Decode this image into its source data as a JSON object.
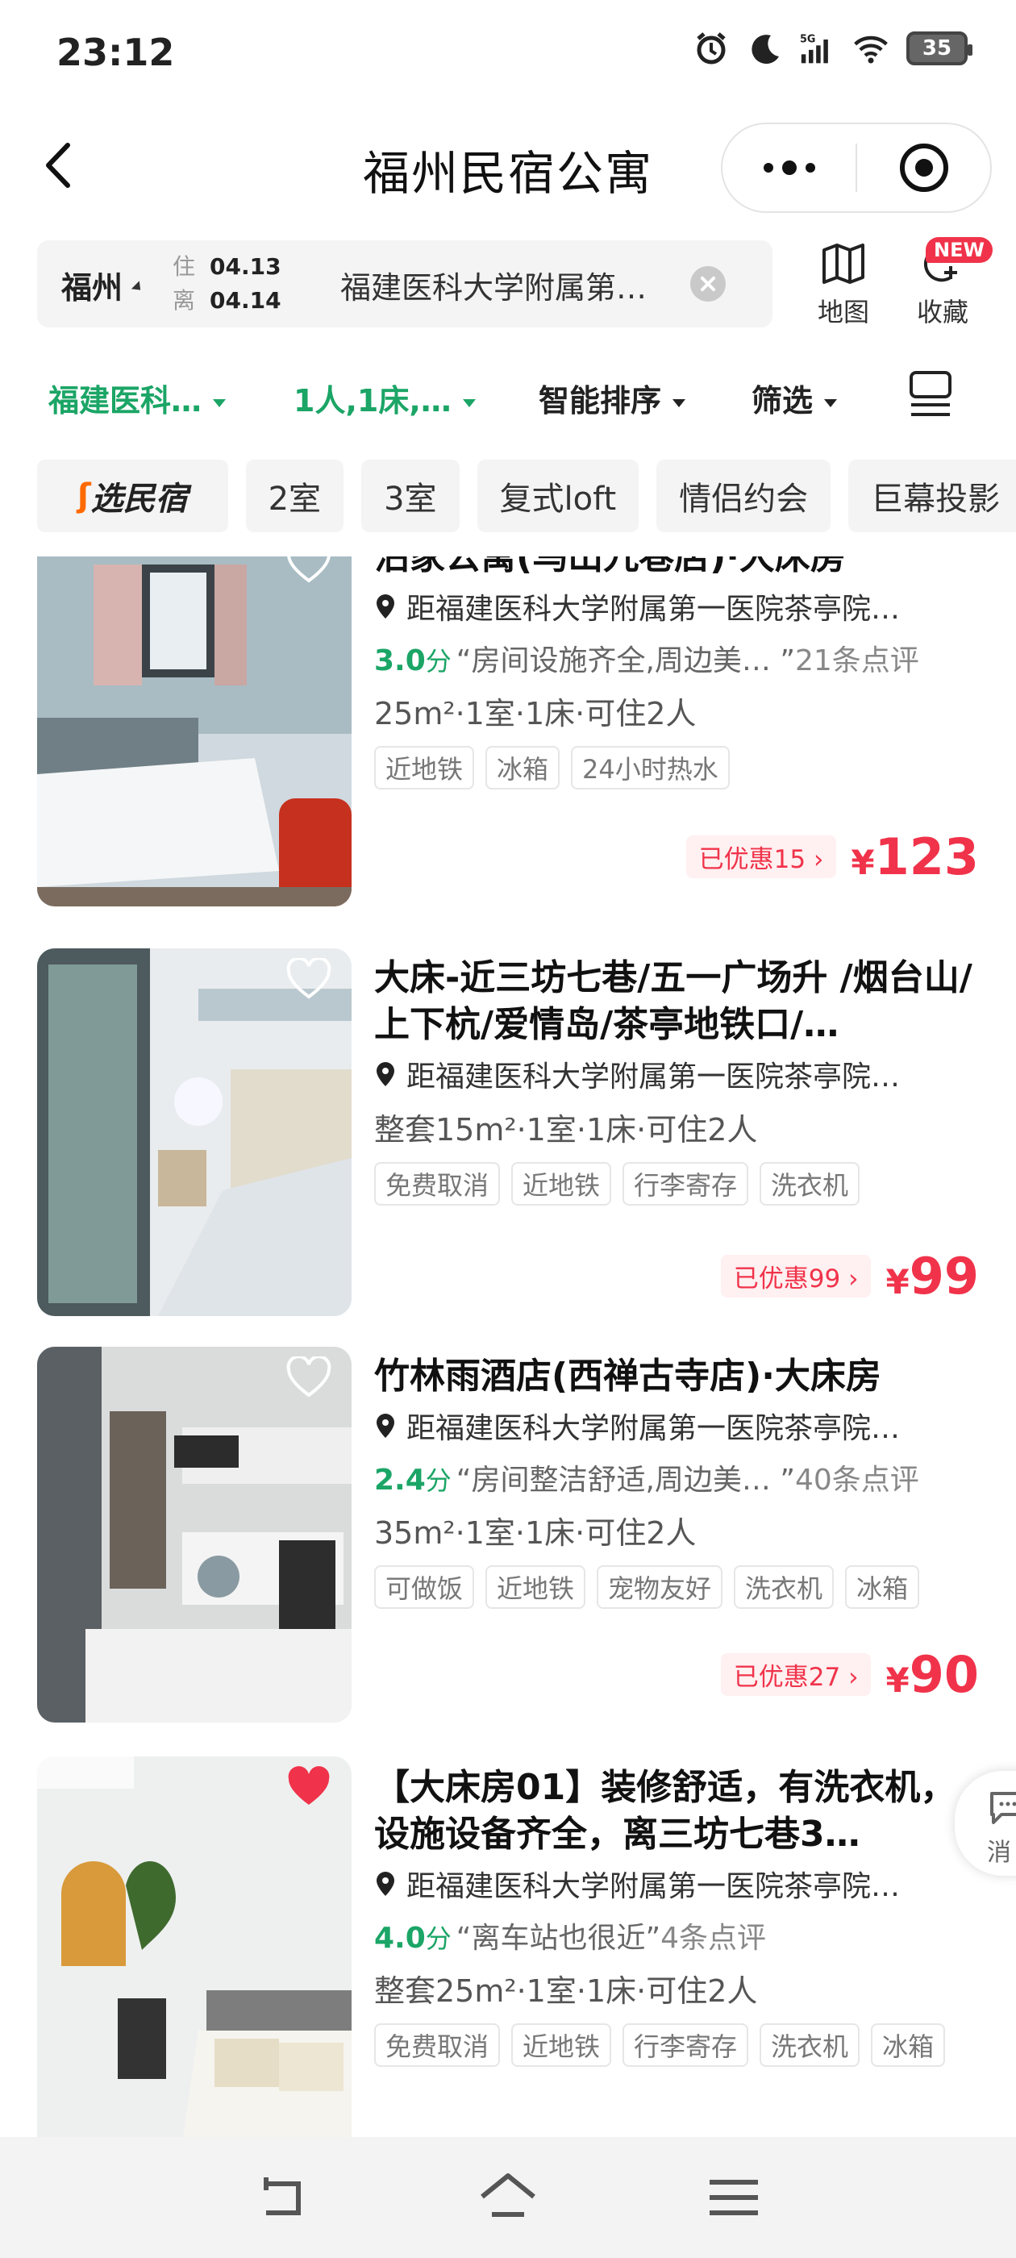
{
  "status": {
    "time": "23:12",
    "battery": "35",
    "network": "5G"
  },
  "nav": {
    "title": "福州民宿公寓"
  },
  "search": {
    "city": "福州",
    "checkin_label": "住",
    "checkin": "04.13",
    "checkout_label": "离",
    "checkout": "04.14",
    "keyword": "福建医科大学附属第…"
  },
  "actions": {
    "map": "地图",
    "favorites": "收藏",
    "new_badge": "NEW"
  },
  "filters": {
    "location": "福建医科…",
    "guests": "1人,1床,…",
    "sort": "智能排序",
    "filter": "筛选"
  },
  "tags": {
    "brand_icon": "ʃ",
    "brand_rest": "选民宿",
    "items": [
      "2室",
      "3室",
      "复式loft",
      "情侣约会",
      "巨幕投影"
    ]
  },
  "listings": [
    {
      "title": "泊家公寓(乌山九巷店)·大床房",
      "location": "距福建医科大学附属第一医院茶亭院…",
      "score": "3.0",
      "score_unit": "分",
      "quote": "“房间设施齐全,周边美… ”",
      "reviews": "21条点评",
      "spec": "25m²·1室·1床·可住2人",
      "tags": [
        "近地铁",
        "冰箱",
        "24小时热水"
      ],
      "discount": "已优惠15 ›",
      "currency": "¥",
      "price": "123",
      "favorited": false
    },
    {
      "title": "大床-近三坊七巷/五一广场升 /烟台山/上下杭/爱情岛/茶亭地铁口/…",
      "location": "距福建医科大学附属第一医院茶亭院…",
      "spec": "整套15m²·1室·1床·可住2人",
      "tags": [
        "免费取消",
        "近地铁",
        "行李寄存",
        "洗衣机"
      ],
      "discount": "已优惠99 ›",
      "currency": "¥",
      "price": "99",
      "favorited": false
    },
    {
      "title": "竹林雨酒店(西禅古寺店)·大床房",
      "location": "距福建医科大学附属第一医院茶亭院…",
      "score": "2.4",
      "score_unit": "分",
      "quote": "“房间整洁舒适,周边美… ”",
      "reviews": "40条点评",
      "spec": "35m²·1室·1床·可住2人",
      "tags": [
        "可做饭",
        "近地铁",
        "宠物友好",
        "洗衣机",
        "冰箱"
      ],
      "discount": "已优惠27 ›",
      "currency": "¥",
      "price": "90",
      "favorited": false
    },
    {
      "title": "【大床房01】装修舒适，有洗衣机，设施设备齐全，离三坊七巷3…",
      "location": "距福建医科大学附属第一医院茶亭院…",
      "score": "4.0",
      "score_unit": "分",
      "quote": "“离车站也很近”",
      "reviews": "4条点评",
      "spec": "整套25m²·1室·1床·可住2人",
      "tags": [
        "免费取消",
        "近地铁",
        "行李寄存",
        "洗衣机",
        "冰箱"
      ],
      "favorited": true
    }
  ],
  "floating": {
    "message": "消"
  },
  "colors": {
    "accent_green": "#1ba566",
    "price_red": "#f0334a"
  }
}
